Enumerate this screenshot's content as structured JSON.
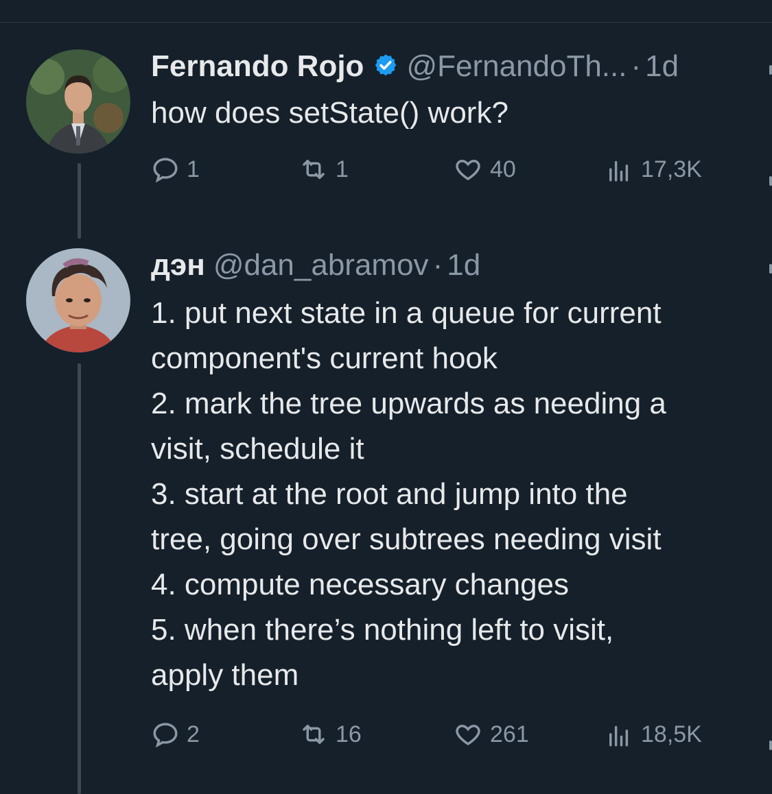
{
  "tweets": [
    {
      "name": "Fernando Rojo",
      "handle": "@FernandoTh...",
      "dot": "·",
      "time": "1d",
      "verified": true,
      "text": "how does setState() work?",
      "replies": "1",
      "retweets": "1",
      "likes": "40",
      "views": "17,3K"
    },
    {
      "name": "дэн",
      "handle": "@dan_abramov",
      "dot": "·",
      "time": "1d",
      "verified": false,
      "text": "1. put next state in a queue for current\ncomponent's current hook\n2. mark the tree upwards as needing a\nvisit, schedule it\n3. start at the root and jump into the\ntree, going over subtrees needing visit\n4. compute necessary changes\n5. when there’s nothing left to visit,\napply them",
      "replies": "2",
      "retweets": "16",
      "likes": "261",
      "views": "18,5K"
    }
  ],
  "colors": {
    "background": "#15202b",
    "text": "#e7e9ea",
    "muted": "#8b98a5",
    "verified": "#1d9bf0",
    "thread": "#3d4852"
  },
  "icons": [
    "verified-badge-icon",
    "reply-icon",
    "retweet-icon",
    "like-icon",
    "views-icon"
  ]
}
